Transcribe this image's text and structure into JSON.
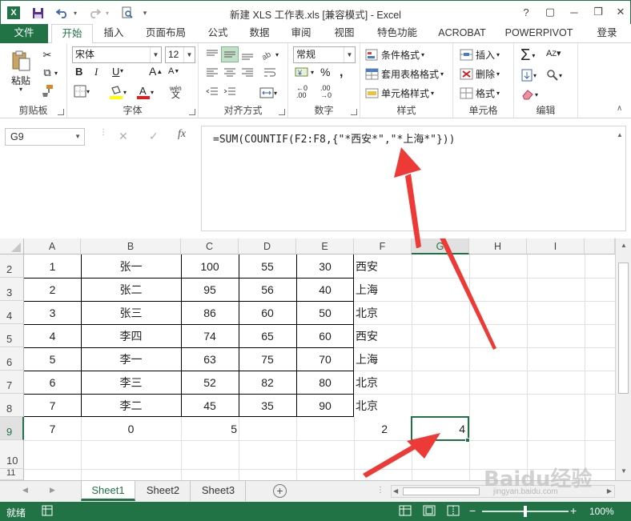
{
  "titlebar": {
    "title": "新建 XLS 工作表.xls  [兼容模式] - Excel",
    "app_icon_label": "X",
    "help": "?",
    "restore": "▢",
    "minimize": "─",
    "close": "✕"
  },
  "tabs": {
    "file": "文件",
    "items": [
      "开始",
      "插入",
      "页面布局",
      "公式",
      "数据",
      "审阅",
      "视图",
      "特色功能",
      "ACROBAT",
      "POWERPIVOT",
      "登录"
    ]
  },
  "ribbon": {
    "clipboard": {
      "paste": "粘贴",
      "label": "剪贴板"
    },
    "font": {
      "name": "宋体",
      "size": "12",
      "bold": "B",
      "italic": "I",
      "underline": "U",
      "grow": "A",
      "shrink": "A",
      "wen": "wén",
      "label": "字体"
    },
    "align": {
      "label": "对齐方式"
    },
    "number": {
      "format": "常规",
      "label": "数字"
    },
    "styles": {
      "conditional": "条件格式",
      "table": "套用表格格式",
      "cell": "单元格样式",
      "label": "样式"
    },
    "cells": {
      "insert": "插入",
      "delete": "删除",
      "format": "格式",
      "label": "单元格"
    },
    "editing": {
      "label": "编辑"
    }
  },
  "formula_bar": {
    "name_box": "G9",
    "fx": "fx",
    "formula": "=SUM(COUNTIF(F2:F8,{\"*西安*\",\"*上海*\"}))"
  },
  "grid": {
    "columns": [
      "A",
      "B",
      "C",
      "D",
      "E",
      "F",
      "G",
      "H",
      "I"
    ],
    "row_numbers": [
      "2",
      "3",
      "4",
      "5",
      "6",
      "7",
      "8",
      "9",
      "10",
      "11"
    ],
    "rows": [
      [
        "1",
        "张一",
        "100",
        "55",
        "30",
        "西安",
        "",
        "",
        ""
      ],
      [
        "2",
        "张二",
        "95",
        "56",
        "40",
        "上海",
        "",
        "",
        ""
      ],
      [
        "3",
        "张三",
        "86",
        "60",
        "50",
        "北京",
        "",
        "",
        ""
      ],
      [
        "4",
        "李四",
        "74",
        "65",
        "60",
        "西安",
        "",
        "",
        ""
      ],
      [
        "5",
        "李一",
        "63",
        "75",
        "70",
        "上海",
        "",
        "",
        ""
      ],
      [
        "6",
        "李三",
        "52",
        "82",
        "80",
        "北京",
        "",
        "",
        ""
      ],
      [
        "7",
        "李二",
        "45",
        "35",
        "90",
        "北京",
        "",
        "",
        ""
      ],
      [
        "7",
        "0",
        "5",
        "",
        "",
        "2",
        "4",
        "",
        ""
      ]
    ],
    "active_cell": "G9"
  },
  "sheets": {
    "tabs": [
      "Sheet1",
      "Sheet2",
      "Sheet3"
    ],
    "active": "Sheet1",
    "add": "+"
  },
  "statusbar": {
    "ready": "就绪",
    "zoom": "100%",
    "zoom_minus": "−",
    "zoom_plus": "+"
  },
  "watermark": {
    "text": "Baidu经验",
    "sub": "jingyan.baidu.com"
  },
  "colors": {
    "excel_green": "#217346",
    "arrow": "#ee3a36"
  }
}
